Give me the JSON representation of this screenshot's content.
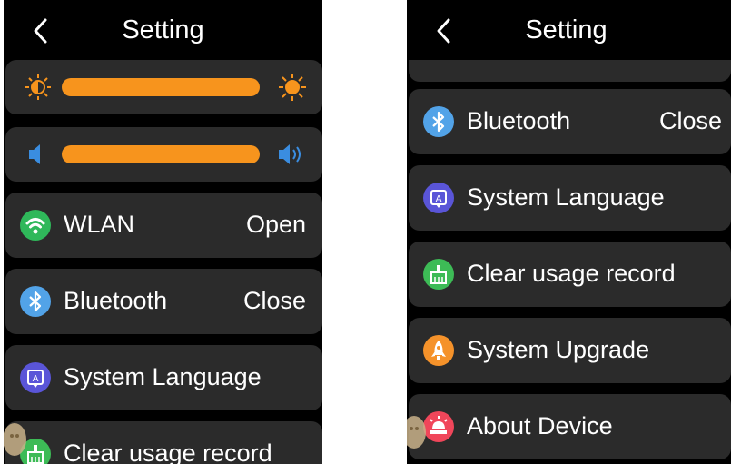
{
  "left": {
    "title": "Setting",
    "rows": [
      {
        "label": "WLAN",
        "value": "Open",
        "icon": "wifi-icon",
        "color": "#2fb85a"
      },
      {
        "label": "Bluetooth",
        "value": "Close",
        "icon": "bluetooth-icon",
        "color": "#52a3e8"
      },
      {
        "label": "System Language",
        "value": "",
        "icon": "language-icon",
        "color": "#5a55d8"
      },
      {
        "label": "Clear usage record",
        "value": "",
        "icon": "broom-icon",
        "color": "#3dbb56"
      }
    ],
    "brightness": {
      "level": 1.0,
      "icon_low": "brightness-low-icon",
      "icon_high": "brightness-high-icon"
    },
    "volume": {
      "level": 1.0,
      "icon_low": "volume-low-icon",
      "icon_high": "volume-high-icon"
    }
  },
  "right": {
    "title": "Setting",
    "rows": [
      {
        "label": "Bluetooth",
        "value": "Close",
        "icon": "bluetooth-icon",
        "color": "#52a3e8"
      },
      {
        "label": "System Language",
        "value": "",
        "icon": "language-icon",
        "color": "#5a55d8"
      },
      {
        "label": "Clear usage record",
        "value": "",
        "icon": "broom-icon",
        "color": "#3dbb56"
      },
      {
        "label": "System Upgrade",
        "value": "",
        "icon": "rocket-icon",
        "color": "#f5922a"
      },
      {
        "label": "About Device",
        "value": "",
        "icon": "about-icon",
        "color": "#f0465a"
      }
    ]
  },
  "colors": {
    "accent": "#f7941d",
    "card": "#2b2b2b",
    "background": "#000000"
  }
}
